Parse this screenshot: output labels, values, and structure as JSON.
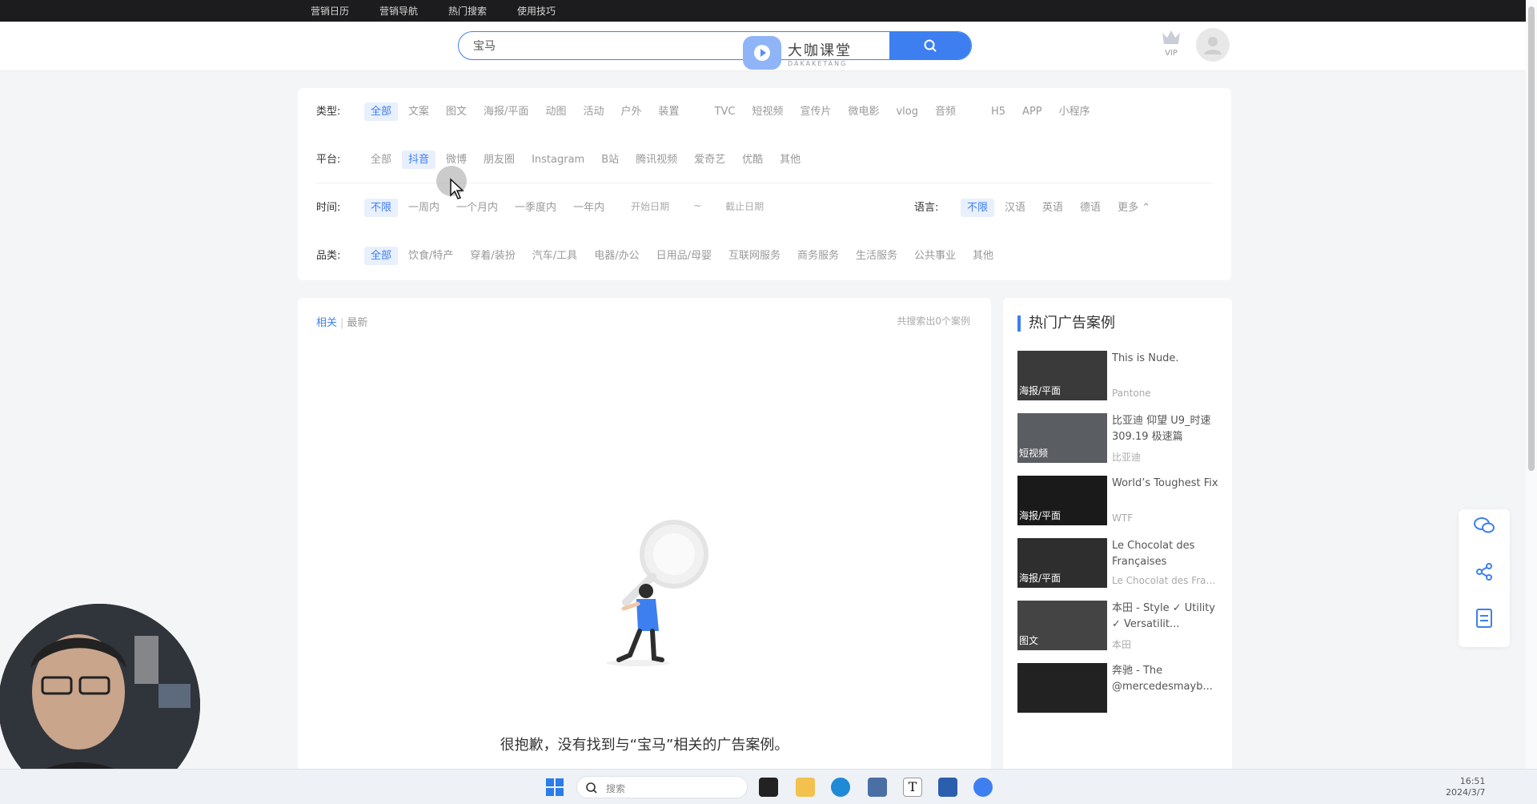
{
  "topnav": [
    "营销日历",
    "营销导航",
    "热门搜索",
    "使用技巧"
  ],
  "search": {
    "value": "宝马"
  },
  "watermark": {
    "name": "大咖课堂",
    "sub": "DAKAKETANG"
  },
  "vip_label": "VIP",
  "filters": {
    "type": {
      "label": "类型:",
      "options": [
        "全部",
        "文案",
        "图文",
        "海报/平面",
        "动图",
        "活动",
        "户外",
        "装置",
        "TVC",
        "短视频",
        "宣传片",
        "微电影",
        "vlog",
        "音频",
        "H5",
        "APP",
        "小程序"
      ],
      "active": "全部"
    },
    "platform": {
      "label": "平台:",
      "options": [
        "全部",
        "抖音",
        "微博",
        "朋友圈",
        "Instagram",
        "B站",
        "腾讯视频",
        "爱奇艺",
        "优酷",
        "其他"
      ],
      "active": "抖音"
    },
    "time": {
      "label": "时间:",
      "options": [
        "不限",
        "一周内",
        "一个月内",
        "一季度内",
        "一年内"
      ],
      "active": "不限",
      "start_placeholder": "开始日期",
      "tilde": "~",
      "end_placeholder": "截止日期"
    },
    "language": {
      "label": "语言:",
      "options": [
        "不限",
        "汉语",
        "英语",
        "德语"
      ],
      "active": "不限",
      "more": "更多"
    },
    "category": {
      "label": "品类:",
      "options": [
        "全部",
        "饮食/特产",
        "穿着/装扮",
        "汽车/工具",
        "电器/办公",
        "日用品/母婴",
        "互联网服务",
        "商务服务",
        "生活服务",
        "公共事业",
        "其他"
      ],
      "active": "全部"
    }
  },
  "results": {
    "tab_relevant": "相关",
    "separator": "|",
    "tab_latest": "最新",
    "count_text": "共搜索出0个案例",
    "empty_message": "很抱歉，没有找到与“宝马”相关的广告案例。"
  },
  "hot": {
    "title": "热门广告案例",
    "cases": [
      {
        "tag": "海报/平面",
        "title": "This is Nude.",
        "brand": "Pantone"
      },
      {
        "tag": "短视频",
        "title": "比亚迪 仰望 U9_时速309.19 极速篇",
        "brand": "比亚迪"
      },
      {
        "tag": "海报/平面",
        "title": "World’s Toughest Fix",
        "brand": "WTF"
      },
      {
        "tag": "海报/平面",
        "title": "Le Chocolat des Françaises",
        "brand": "Le Chocolat des Fran..."
      },
      {
        "tag": "图文",
        "title": "本田 - Style ✓ Utility ✓ Versatilit...",
        "brand": "本田"
      },
      {
        "tag": "",
        "title": "奔驰 - The @mercedesmayb...",
        "brand": ""
      }
    ]
  },
  "taskbar": {
    "search_placeholder": "搜索",
    "time": "16:51",
    "date": "2024/3/7"
  },
  "colors": {
    "accent": "#3d7ff0",
    "topbar": "#1c1c1e",
    "active_bg": "#e8effd"
  }
}
